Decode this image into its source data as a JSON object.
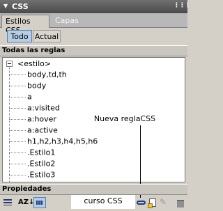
{
  "panel": {
    "title": "CSS"
  },
  "tabs": [
    {
      "label": "Estilos CSS"
    },
    {
      "label": "Capas"
    }
  ],
  "filters": {
    "all_label": "Todo",
    "current_label": "Actual"
  },
  "sections": {
    "all_rules": "Todas las reglas",
    "properties": "Propiedades"
  },
  "tree": {
    "root": "<estilo>",
    "items": [
      "body,td,th",
      "body",
      "a",
      "a:visited",
      "a:hover",
      "a:active",
      "h1,h2,h3,h4,h5,h6",
      ".Estilo1",
      ".Estilo2",
      ".Estilo3"
    ]
  },
  "annotation": "Nueva reglaCSS",
  "bottom": {
    "az_icon": "AZ↓",
    "caption": "curso CSS",
    "edit_icon": "✎"
  },
  "icons": {
    "collapse": "arrow-down-icon",
    "gripper": "gripper-icon",
    "list_view": "list-view-icon",
    "sort_az": "sort-az-icon",
    "set_props": "set-properties-icon",
    "attach": "attach-stylesheet-icon",
    "new_rule": "new-css-rule-icon",
    "edit": "edit-style-icon",
    "delete": "trash-icon"
  },
  "colors": {
    "header_bg": "#4a4a4a",
    "selected_button": "#b7cde6",
    "panel_bg": "#d4d0c8"
  }
}
